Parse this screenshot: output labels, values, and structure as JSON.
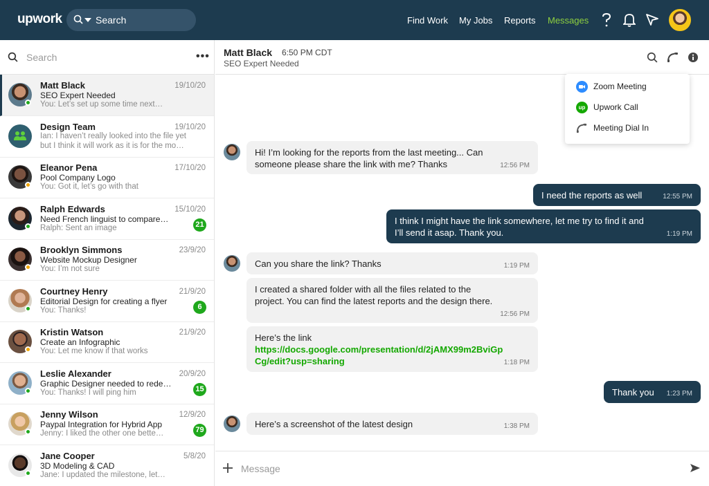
{
  "app": {
    "logo": "upwork"
  },
  "topbar": {
    "search_label": "Search",
    "nav": [
      "Find Work",
      "My Jobs",
      "Reports",
      "Messages"
    ],
    "active": "Messages",
    "icons": [
      "help-icon",
      "bell-icon",
      "send-icon"
    ]
  },
  "sidebar": {
    "search_placeholder": "Search",
    "more_label": "•••",
    "conversations": [
      {
        "name": "Matt Black",
        "date": "19/10/20",
        "subject": "SEO Expert Needed",
        "preview": "You: Let’s set up some time next…",
        "status": "online",
        "badge": ""
      },
      {
        "name": "Design Team",
        "date": "19/10/20",
        "subject": "Ian: I haven’t really looked into the file yet",
        "preview": "but I think it will work as it is for the mo…",
        "status": "",
        "badge": ""
      },
      {
        "name": "Eleanor Pena",
        "date": "17/10/20",
        "subject": "Pool Company Logo",
        "preview": "You: Got it, let’s go with that",
        "status": "away",
        "badge": ""
      },
      {
        "name": "Ralph Edwards",
        "date": "15/10/20",
        "subject": "Need French linguist to compare…",
        "preview": "Ralph: Sent an image",
        "status": "online",
        "badge": "21"
      },
      {
        "name": "Brooklyn Simmons",
        "date": "23/9/20",
        "subject": "Website Mockup Designer",
        "preview": "You: I’m not sure",
        "status": "away",
        "badge": ""
      },
      {
        "name": "Courtney Henry",
        "date": "21/9/20",
        "subject": "Editorial Design for creating a flyer",
        "preview": "You: Thanks!",
        "status": "online",
        "badge": "6"
      },
      {
        "name": "Kristin Watson",
        "date": "21/9/20",
        "subject": "Create an Infographic",
        "preview": "You: Let me know if that works",
        "status": "away",
        "badge": ""
      },
      {
        "name": "Leslie Alexander",
        "date": "20/9/20",
        "subject": "Graphic Designer needed to rede…",
        "preview": "You: Thanks! I will ping him",
        "status": "online",
        "badge": "15"
      },
      {
        "name": "Jenny Wilson",
        "date": "12/9/20",
        "subject": "Paypal Integration for Hybrid App",
        "preview": "Jenny: I liked the other one bette…",
        "status": "online",
        "badge": "79"
      },
      {
        "name": "Jane Cooper",
        "date": "5/8/20",
        "subject": "3D Modeling & CAD",
        "preview": "Jane: I updated the milestone, let…",
        "status": "online",
        "badge": ""
      }
    ]
  },
  "chat": {
    "contact_name": "Matt Black",
    "contact_time": "6:50 PM CDT",
    "job_title": "SEO Expert Needed",
    "dropdown": [
      "Zoom Meeting",
      "Upwork Call",
      "Meeting Dial In"
    ],
    "messages": [
      {
        "dir": "in",
        "lines": [
          "Hi! I’m looking for the reports from the last meeting... Can",
          "someone please share the link with me? Thanks"
        ],
        "time": "12:56 PM"
      },
      {
        "dir": "out",
        "lines": [
          "I need the reports as well"
        ],
        "time": "12:55 PM"
      },
      {
        "dir": "out",
        "lines": [
          "I think I might have the link somewhere, let me try to find it and",
          "I’ll send it asap. Thank you."
        ],
        "time": "1:19 PM"
      },
      {
        "dir": "in",
        "lines": [
          "Can you share the link? Thanks"
        ],
        "time": "1:19 PM"
      },
      {
        "dir": "in",
        "lines": [
          "I created a shared folder with all the files related to the",
          "project. You can find the latest reports and the design there."
        ],
        "time": "12:56 PM"
      },
      {
        "dir": "in",
        "lines": [
          "Here’s the link"
        ],
        "link_lines": [
          "https://docs.google.com/presentation/d/2jAMX99m2BviGp",
          "Cg/edit?usp=sharing"
        ],
        "time": "1:18 PM"
      },
      {
        "dir": "out",
        "lines": [
          "Thank you"
        ],
        "time": "1:23 PM"
      },
      {
        "dir": "in",
        "lines": [
          "Here’s a screenshot of the latest design"
        ],
        "time": "1:38 PM"
      }
    ],
    "composer_placeholder": "Message"
  },
  "colors": {
    "header_bg": "#1d3b4f",
    "accent_green": "#14a800",
    "nav_active": "#8fd13f",
    "status_online": "#1fa81c",
    "status_away": "#f0a500",
    "zoom_blue": "#2d8cff"
  }
}
